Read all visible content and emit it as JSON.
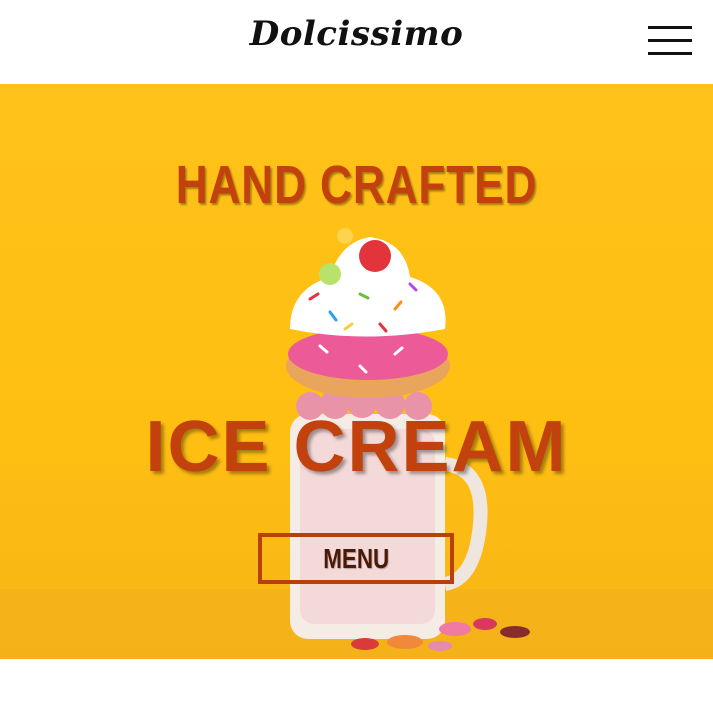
{
  "header": {
    "logo_text": "Dolcissimo",
    "menu_icon": "hamburger-icon"
  },
  "hero": {
    "title": "HAND CRAFTED",
    "headline": "ICE CREAM",
    "cta_label": "MENU",
    "colors": {
      "background": "#ffc21a",
      "accent": "#c2410c",
      "button_border": "#b9400b"
    }
  }
}
